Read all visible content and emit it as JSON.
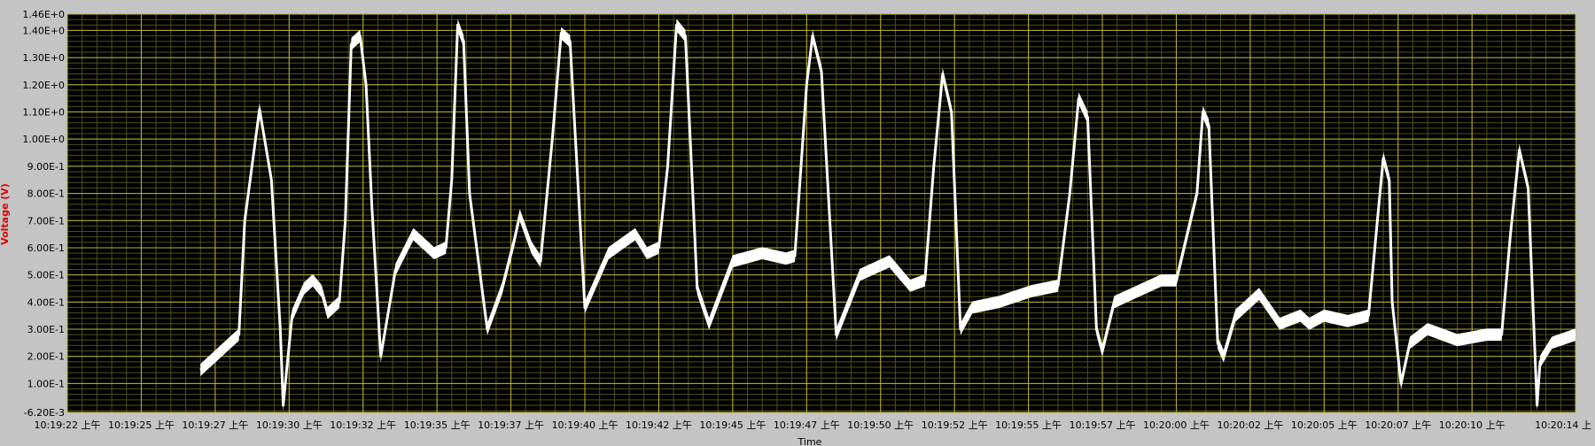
{
  "chart_data": {
    "type": "line",
    "xlabel": "Time",
    "ylabel": "Voltage (V)",
    "ylim": [
      -0.0062,
      1.46
    ],
    "grid": true,
    "colors": {
      "plot_background": "#000000",
      "major_grid": "#b8b23a",
      "minor_grid": "#4f4f1c",
      "series": "#ffffff",
      "frame": "#c4c4c4",
      "ylabel": "#e00000"
    },
    "y_ticks": [
      "1.46E+0",
      "1.40E+0",
      "1.30E+0",
      "1.20E+0",
      "1.10E+0",
      "1.00E+0",
      "9.00E-1",
      "8.00E-1",
      "7.00E-1",
      "6.00E-1",
      "5.00E-1",
      "4.00E-1",
      "3.00E-1",
      "2.00E-1",
      "1.00E-1",
      "-6.20E-3"
    ],
    "y_tick_values": [
      1.46,
      1.4,
      1.3,
      1.2,
      1.1,
      1.0,
      0.9,
      0.8,
      0.7,
      0.6,
      0.5,
      0.4,
      0.3,
      0.2,
      0.1,
      -0.0062
    ],
    "x_ticks": [
      "10:19:22 上午",
      "10:19:25 上午",
      "10:19:27 上午",
      "10:19:30 上午",
      "10:19:32 上午",
      "10:19:35 上午",
      "10:19:37 上午",
      "10:19:40 上午",
      "10:19:42 上午",
      "10:19:45 上午",
      "10:19:47 上午",
      "10:19:50 上午",
      "10:19:52 上午",
      "10:19:55 上午",
      "10:19:57 上午",
      "10:20:00 上午",
      "10:20:02 上午",
      "10:20:05 上午",
      "10:20:07 上午",
      "10:20:10 上午",
      "10:20:14 上"
    ],
    "x_tick_seconds": [
      0,
      2.5,
      5,
      7.5,
      10,
      12.5,
      15,
      17.5,
      20,
      22.5,
      25,
      27.5,
      30,
      32.5,
      35,
      37.5,
      40,
      42.5,
      45,
      47.5,
      51
    ],
    "x_range_seconds": [
      0,
      51
    ],
    "series": [
      {
        "band_width_volts": 0.045,
        "x_seconds": [
          4.5,
          5.5,
          5.8,
          6.0,
          6.5,
          6.9,
          7.2,
          7.3,
          7.6,
          8.0,
          8.3,
          8.6,
          8.8,
          9.2,
          9.4,
          9.6,
          9.9,
          10.1,
          10.3,
          10.6,
          11.1,
          11.7,
          12.4,
          12.8,
          13.0,
          13.2,
          13.4,
          13.6,
          14.2,
          14.7,
          15.1,
          15.3,
          15.7,
          16.0,
          16.4,
          16.7,
          17.0,
          17.5,
          18.3,
          19.2,
          19.6,
          20.0,
          20.3,
          20.6,
          20.9,
          21.3,
          21.7,
          22.5,
          23.5,
          24.3,
          24.6,
          25.0,
          25.2,
          25.5,
          26.0,
          26.8,
          27.8,
          28.5,
          29.0,
          29.3,
          29.6,
          29.9,
          30.2,
          30.6,
          31.5,
          32.6,
          33.5,
          33.9,
          34.2,
          34.5,
          34.8,
          35.0,
          35.4,
          36.0,
          37.0,
          37.5,
          38.2,
          38.4,
          38.6,
          38.9,
          39.1,
          39.5,
          40.3,
          41.0,
          41.7,
          42.0,
          42.5,
          43.3,
          44.0,
          44.3,
          44.5,
          44.7,
          44.8,
          45.1,
          45.4,
          46.0,
          47.0,
          48.0,
          48.5,
          48.8,
          49.1,
          49.4,
          49.7,
          49.8,
          50.2,
          51.0
        ],
        "y_volts": [
          0.15,
          0.25,
          0.28,
          0.7,
          1.11,
          0.85,
          0.3,
          0.02,
          0.35,
          0.45,
          0.48,
          0.44,
          0.36,
          0.4,
          0.7,
          1.35,
          1.38,
          1.2,
          0.75,
          0.2,
          0.52,
          0.65,
          0.58,
          0.6,
          0.85,
          1.42,
          1.36,
          0.8,
          0.3,
          0.45,
          0.62,
          0.72,
          0.6,
          0.55,
          1.0,
          1.39,
          1.36,
          0.38,
          0.58,
          0.65,
          0.58,
          0.6,
          0.9,
          1.42,
          1.38,
          0.45,
          0.32,
          0.55,
          0.58,
          0.56,
          0.57,
          1.2,
          1.38,
          1.25,
          0.28,
          0.5,
          0.55,
          0.46,
          0.48,
          0.9,
          1.24,
          1.1,
          0.3,
          0.38,
          0.4,
          0.44,
          0.46,
          0.8,
          1.15,
          1.08,
          0.3,
          0.22,
          0.4,
          0.43,
          0.48,
          0.48,
          0.8,
          1.1,
          1.05,
          0.25,
          0.2,
          0.35,
          0.43,
          0.32,
          0.35,
          0.32,
          0.35,
          0.33,
          0.35,
          0.7,
          0.93,
          0.85,
          0.4,
          0.1,
          0.25,
          0.3,
          0.26,
          0.28,
          0.28,
          0.65,
          0.96,
          0.82,
          0.02,
          0.18,
          0.25,
          0.28
        ]
      }
    ]
  }
}
